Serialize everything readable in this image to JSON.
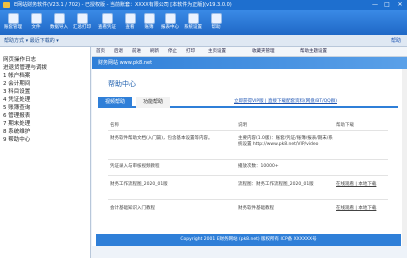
{
  "window": {
    "title": "E网站财务软件(V23.1 / 702) - 已授权版 - 当前账套：XXXX有限公司 [本软件为正版](v19.3.0.0)",
    "minimize": "—",
    "maximize": "□",
    "close": "✕"
  },
  "toolbar": {
    "items": [
      {
        "label": "账套管理"
      },
      {
        "label": "文件"
      },
      {
        "label": "数据导入"
      },
      {
        "label": "汇总打印"
      },
      {
        "label": "查看凭证"
      },
      {
        "label": "查看"
      },
      {
        "label": "账簿"
      },
      {
        "label": "报表中心"
      },
      {
        "label": "系统设置"
      },
      {
        "label": "帮助"
      }
    ]
  },
  "subbar": {
    "left": "帮助方式 ▾  最近下载的 ▾",
    "right": "帮助"
  },
  "sidebar": {
    "items": [
      {
        "label": "网页操作日志"
      },
      {
        "label": "进退货管理与调拨"
      },
      {
        "label": "1 帐户档案"
      },
      {
        "label": "2 会计期间"
      },
      {
        "label": "3 科目设置"
      },
      {
        "label": "4 凭证处理"
      },
      {
        "label": "5 账簿查询"
      },
      {
        "label": "6 管理报表"
      },
      {
        "label": "7 期末处理"
      },
      {
        "label": "8 系统维护"
      },
      {
        "label": "9 帮助中心"
      }
    ]
  },
  "cnav": {
    "buttons": [
      {
        "label": "首页"
      },
      {
        "label": "后退"
      },
      {
        "label": "前进"
      },
      {
        "label": "刷新"
      },
      {
        "label": "停止"
      },
      {
        "label": "打印"
      },
      {
        "label": "主页设置"
      },
      {
        "label": "收藏夹管理"
      },
      {
        "label": "帮助主题设置"
      }
    ]
  },
  "banner": {
    "text": "财务网站 www.pk8.net"
  },
  "page": {
    "heading": "帮助中心",
    "tabs": [
      {
        "label": "视频帮助"
      },
      {
        "label": "功能帮助"
      }
    ],
    "top_links": "立即获得VIP版 | 直接下载配套资料(网盘/BT/QQ群)",
    "table": {
      "headers": [
        "名称",
        "说明",
        "帮助下载"
      ],
      "rows": [
        {
          "name": "财务软件帮助文档(入门篇)，包含基本设置等内容。",
          "desc": "主要内容(1.0版)：账套/凭证/账簿/报表/期末/系统设置 http://www.pk8.net/VIP/video",
          "action": ""
        },
        {
          "name": "凭证录入与审核视频教程",
          "desc": "播放次数：10000+",
          "action": ""
        },
        {
          "name": "财务工作流程图_2020_01版",
          "desc": "流程图：财务工作流程图_2020_01版",
          "action": "在线观看 | 本地下载"
        },
        {
          "name": "会计基础知识入门教程",
          "desc": "财务软件基础教程",
          "action": "在线观看 | 本地下载"
        }
      ]
    },
    "footer": "Copyright 2001 E财务网站 (pk8.net) 版权所有 ICP备 XXXXXX号"
  }
}
